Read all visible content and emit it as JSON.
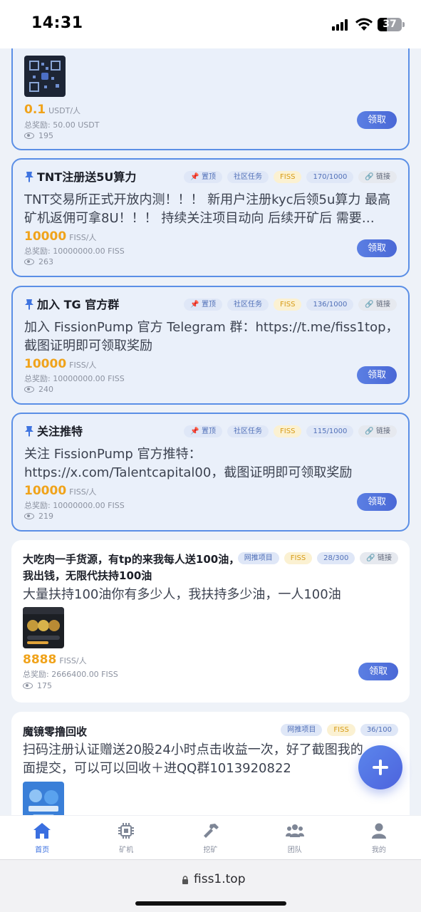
{
  "status_bar": {
    "time": "14:31",
    "battery": "37"
  },
  "cards": [
    {
      "reward_value": "0.1",
      "reward_unit": "USDT/人",
      "total": "总奖励: 50.00 USDT",
      "views": "195",
      "claim": "领取"
    },
    {
      "title": "TNT注册送5U算力",
      "tags": [
        "📌 置顶",
        "社区任务",
        "FISS",
        "170/1000",
        "🔗 链接"
      ],
      "desc": "TNT交易所正式开放内测！！！ 新用户注册kyc后领5u算力 最高矿机返佣可拿8U！！！ 持续关注项目动向 后续开矿后 需要…",
      "reward_value": "10000",
      "reward_unit": "FISS/人",
      "total": "总奖励: 10000000.00 FISS",
      "views": "263",
      "claim": "领取"
    },
    {
      "title": "加入 TG 官方群",
      "tags": [
        "📌 置顶",
        "社区任务",
        "FISS",
        "136/1000",
        "🔗 链接"
      ],
      "desc": "加入 FissionPump 官方 Telegram 群：https://t.me/fiss1top，截图证明即可领取奖励",
      "reward_value": "10000",
      "reward_unit": "FISS/人",
      "total": "总奖励: 10000000.00 FISS",
      "views": "240",
      "claim": "领取"
    },
    {
      "title": "关注推特",
      "tags": [
        "📌 置顶",
        "社区任务",
        "FISS",
        "115/1000",
        "🔗 链接"
      ],
      "desc": "关注 FissionPump 官方推特：https://x.com/Talentcapital00，截图证明即可领取奖励",
      "reward_value": "10000",
      "reward_unit": "FISS/人",
      "total": "总奖励: 10000000.00 FISS",
      "views": "219",
      "claim": "领取"
    },
    {
      "title": "大吃肉一手货源，有tp的来我每人送100油，我出钱，无限代扶持100油",
      "tags": [
        "网推项目",
        "FISS",
        "28/300",
        "🔗 链接"
      ],
      "desc": "大量扶持100油你有多少人，我扶持多少油，一人100油",
      "reward_value": "8888",
      "reward_unit": "FISS/人",
      "total": "总奖励: 2666400.00 FISS",
      "views": "175",
      "claim": "领取"
    },
    {
      "title": "魔镜零撸回收",
      "tags": [
        "网推项目",
        "FISS",
        "36/100"
      ],
      "desc": "扫码注册认证赠送20股24小时点击收益一次，好了截图我的面提交，可以可以回收＋进QQ群1013920822"
    }
  ],
  "nav": [
    "首页",
    "矿机",
    "挖矿",
    "团队",
    "我的"
  ],
  "safari": {
    "url": "fiss1.top"
  }
}
